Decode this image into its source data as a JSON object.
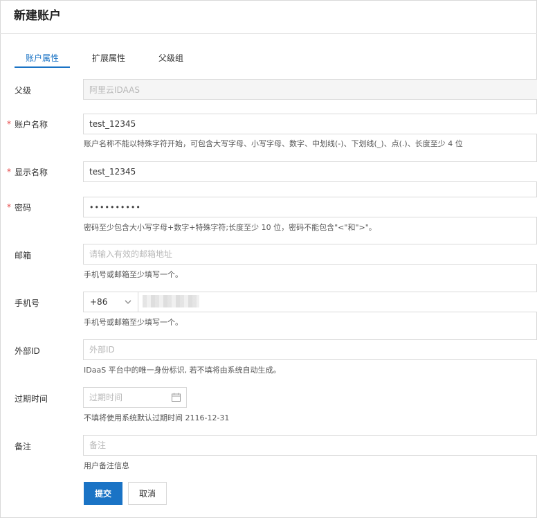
{
  "page_title": "新建账户",
  "tabs": [
    {
      "label": "账户属性",
      "active": true
    },
    {
      "label": "扩展属性",
      "active": false
    },
    {
      "label": "父级组",
      "active": false
    }
  ],
  "form": {
    "parent": {
      "label": "父级",
      "value": "阿里云IDAAS"
    },
    "account_name": {
      "label": "账户名称",
      "value": "test_12345",
      "help": "账户名称不能以特殊字符开始，可包含大写字母、小写字母、数字、中划线(-)、下划线(_)、点(.)、长度至少 4 位"
    },
    "display_name": {
      "label": "显示名称",
      "value": "test_12345"
    },
    "password": {
      "label": "密码",
      "value": "••••••••••",
      "help": "密码至少包含大小写字母+数字+特殊字符;长度至少 10 位，密码不能包含\"<\"和\">\"。"
    },
    "email": {
      "label": "邮箱",
      "placeholder": "请输入有效的邮箱地址",
      "help": "手机号或邮箱至少填写一个。"
    },
    "phone": {
      "label": "手机号",
      "country_code": "+86",
      "help": "手机号或邮箱至少填写一个。"
    },
    "external_id": {
      "label": "外部ID",
      "placeholder": "外部ID",
      "help": "IDaaS 平台中的唯一身份标识, 若不填将由系统自动生成。"
    },
    "expire_time": {
      "label": "过期时间",
      "placeholder": "过期时间",
      "help": "不填将使用系统默认过期时间 2116-12-31"
    },
    "remark": {
      "label": "备注",
      "placeholder": "备注",
      "help": "用户备注信息"
    },
    "required_mark": "*"
  },
  "buttons": {
    "submit": "提交",
    "cancel": "取消"
  },
  "colors": {
    "primary": "#1a73c5",
    "required": "#e64545",
    "border": "#d9d9d9"
  },
  "icons": {
    "country_code_dropdown": "chevron-down-icon",
    "date_picker": "calendar-icon"
  }
}
